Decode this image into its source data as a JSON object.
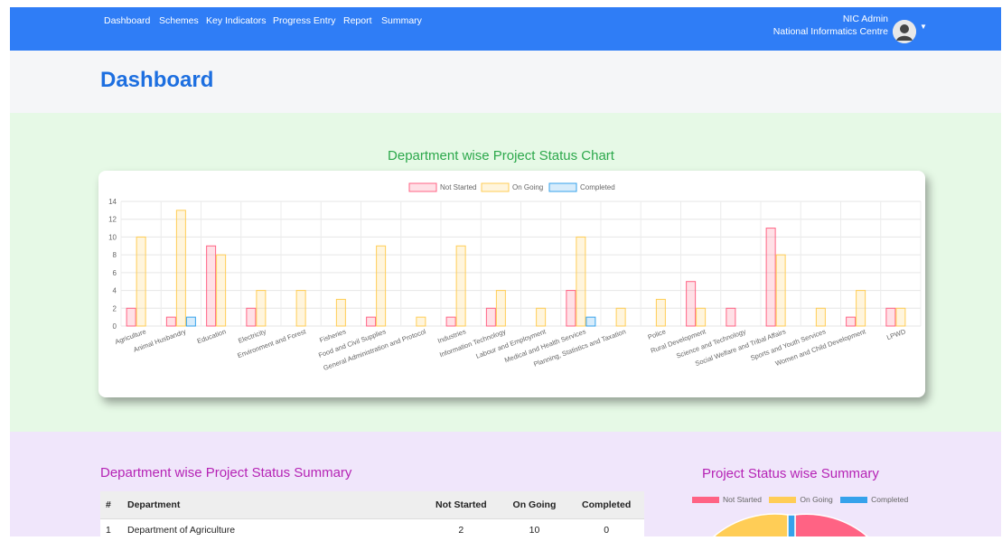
{
  "nav": {
    "links": [
      "Dashboard",
      "Schemes",
      "Key Indicators",
      "Progress Entry",
      "Report",
      "Summary"
    ],
    "user_name": "NIC Admin",
    "user_org": "National Informatics Centre"
  },
  "page": {
    "title": "Dashboard"
  },
  "chart_section": {
    "title": "Department wise Project Status Chart"
  },
  "chart_data": {
    "type": "bar",
    "categories": [
      "Agriculture",
      "Animal Husbandry",
      "Education",
      "Electricity",
      "Environment and Forest",
      "Fisheries",
      "Food and Civil Supplies",
      "General Administration and Protocol",
      "Industries",
      "Information Technology",
      "Labour and Employment",
      "Medical and Health Services",
      "Planning, Statistics and Taxation",
      "Police",
      "Rural Development",
      "Science and Technology",
      "Social Welfare and Tribal Affairs",
      "Sports and Youth Services",
      "Women and Child Development",
      "LPWD"
    ],
    "series": [
      {
        "name": "Not Started",
        "values": [
          2,
          1,
          9,
          2,
          0,
          0,
          1,
          0,
          1,
          2,
          0,
          4,
          0,
          0,
          5,
          2,
          11,
          0,
          1,
          2
        ]
      },
      {
        "name": "On Going",
        "values": [
          10,
          13,
          8,
          4,
          4,
          3,
          9,
          1,
          9,
          4,
          2,
          10,
          2,
          3,
          2,
          0,
          8,
          2,
          4,
          2
        ]
      },
      {
        "name": "Completed",
        "values": [
          0,
          1,
          0,
          0,
          0,
          0,
          0,
          0,
          0,
          0,
          0,
          1,
          0,
          0,
          0,
          0,
          0,
          0,
          0,
          0
        ]
      }
    ],
    "colors": {
      "Not Started": "#ff6384",
      "On Going": "#ffcd56",
      "Completed": "#36a2eb"
    },
    "ylim": [
      0,
      14
    ],
    "yticks": [
      0,
      2,
      4,
      6,
      8,
      10,
      12,
      14
    ],
    "grid": true,
    "legend": "top"
  },
  "summary": {
    "title": "Department wise Project Status Summary",
    "columns": [
      "#",
      "Department",
      "Not Started",
      "On Going",
      "Completed"
    ],
    "rows": [
      [
        "1",
        "Department of Agriculture",
        "2",
        "10",
        "0"
      ]
    ]
  },
  "pie": {
    "title": "Project Status wise Summary",
    "legend": [
      "Not Started",
      "On Going",
      "Completed"
    ],
    "colors": [
      "#ff6384",
      "#ffcd56",
      "#36a2eb"
    ]
  }
}
